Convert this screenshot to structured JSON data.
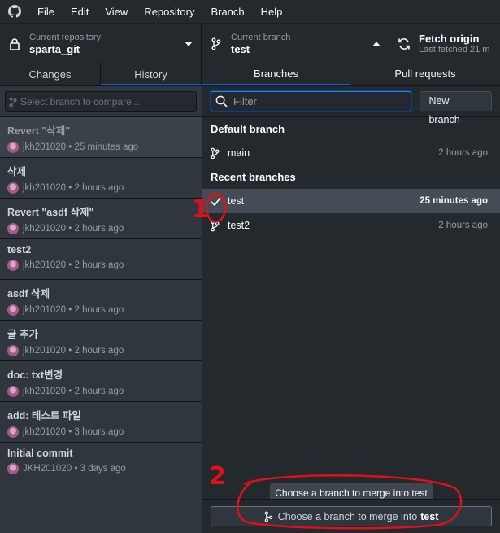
{
  "menu": {
    "items": [
      "File",
      "Edit",
      "View",
      "Repository",
      "Branch",
      "Help"
    ]
  },
  "toolbar": {
    "repo_label": "Current repository",
    "repo_value": "sparta_git",
    "branch_label": "Current branch",
    "branch_value": "test",
    "fetch_label": "Fetch origin",
    "fetch_sub": "Last fetched 21 m"
  },
  "left": {
    "tabs": [
      "Changes",
      "History"
    ],
    "compare_placeholder": "Select branch to compare...",
    "commits": [
      {
        "title": "Revert \"삭제\"",
        "author": "jkh201020",
        "time": "• 25 minutes ago"
      },
      {
        "title": "삭제",
        "author": "jkh201020",
        "time": "• 2 hours ago"
      },
      {
        "title": "Revert \"asdf 삭제\"",
        "author": "jkh201020",
        "time": "• 2 hours ago"
      },
      {
        "title": "test2",
        "author": "jkh201020",
        "time": "• 2 hours ago"
      },
      {
        "title": "asdf 삭제",
        "author": "jkh201020",
        "time": "• 2 hours ago"
      },
      {
        "title": "글 추가",
        "author": "jkh201020",
        "time": "• 2 hours ago"
      },
      {
        "title": "doc: txt변경",
        "author": "jkh201020",
        "time": "• 2 hours ago"
      },
      {
        "title": "add: 테스트 파일",
        "author": "jkh201020",
        "time": "• 3 hours ago"
      },
      {
        "title": "Initial commit",
        "author": "JKH201020",
        "time": "• 3 days ago"
      }
    ]
  },
  "right": {
    "tabs": [
      "Branches",
      "Pull requests"
    ],
    "filter_placeholder": "Filter",
    "new_branch_label": "New branch",
    "default_header": "Default branch",
    "default_branch": {
      "name": "main",
      "time": "2 hours ago"
    },
    "recent_header": "Recent branches",
    "recent_branches": [
      {
        "name": "test",
        "time": "25 minutes ago"
      },
      {
        "name": "test2",
        "time": "2 hours ago"
      }
    ],
    "tooltip": "Choose a branch to merge into test",
    "merge_prefix": "Choose a branch to merge into",
    "merge_target": "test"
  },
  "annotations": {
    "mark1": "1",
    "mark2": "2",
    "color": "#e0101b"
  }
}
